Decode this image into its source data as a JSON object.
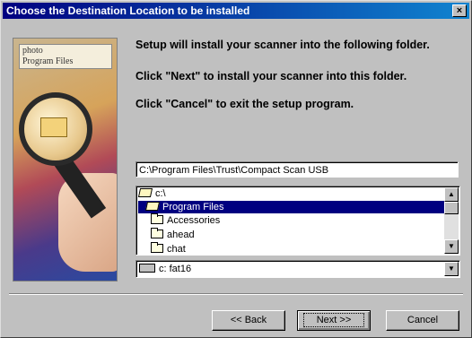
{
  "window": {
    "title": "Choose the Destination Location to be installed",
    "close_glyph": "×"
  },
  "artwork": {
    "folders": [
      "photo",
      "Program Files"
    ]
  },
  "messages": [
    "Setup will install your scanner into the following folder.",
    "Click \"Next\" to install your scanner into this folder.",
    "Click \"Cancel\" to exit the setup program."
  ],
  "path": {
    "value": "C:\\Program Files\\Trust\\Compact Scan USB"
  },
  "folders": [
    {
      "name": "c:\\",
      "icon": "open-folder-icon"
    },
    {
      "name": "Program Files",
      "icon": "open-folder-icon",
      "selected": true
    },
    {
      "name": "Accessories",
      "icon": "folder-icon"
    },
    {
      "name": "ahead",
      "icon": "folder-icon"
    },
    {
      "name": "chat",
      "icon": "folder-icon"
    }
  ],
  "drive": {
    "value": "c:  fat16",
    "icon": "drive-icon"
  },
  "buttons": {
    "back": "<< Back",
    "next": "Next >>",
    "cancel": "Cancel"
  },
  "colors": {
    "title_bar": "#000080",
    "selection": "#000080",
    "face": "#c0c0c0"
  }
}
